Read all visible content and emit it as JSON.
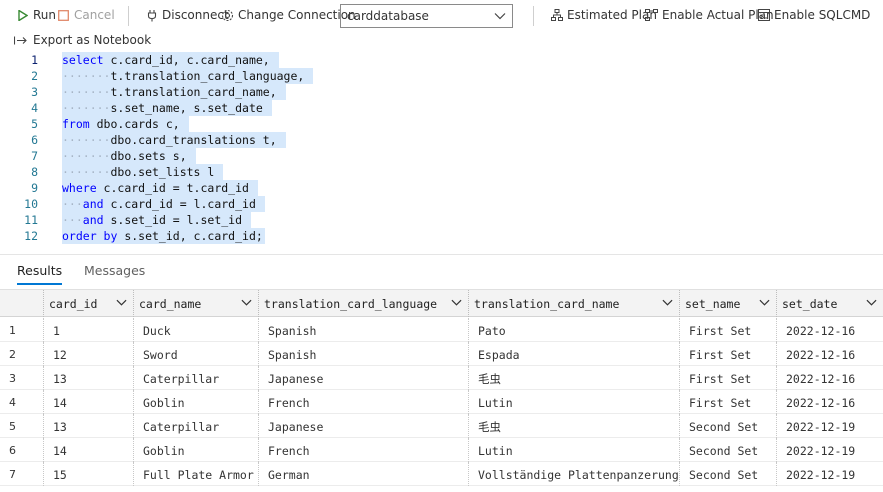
{
  "toolbar": {
    "run_label": "Run",
    "cancel_label": "Cancel",
    "disconnect_label": "Disconnect",
    "change_connection_label": "Change Connection",
    "database_selected": "carddatabase",
    "estimated_plan_label": "Estimated Plan",
    "actual_plan_label": "Enable Actual Plan",
    "sqlcmd_label": "Enable SQLCMD",
    "export_label": "Export as Notebook"
  },
  "editor": {
    "line_numbers": [
      "1",
      "2",
      "3",
      "4",
      "5",
      "6",
      "7",
      "8",
      "9",
      "10",
      "11",
      "12"
    ],
    "lines": [
      {
        "kw": "select",
        "text": " c.card_id, c.card_name, "
      },
      {
        "indent": "·······",
        "text": "t.translation_card_language, "
      },
      {
        "indent": "·······",
        "text": "t.translation_card_name, "
      },
      {
        "indent": "·······",
        "text": "s.set_name, s.set_date "
      },
      {
        "kw": "from",
        "text": " dbo.cards c, "
      },
      {
        "indent": "·······",
        "text": "dbo.card_translations t, "
      },
      {
        "indent": "·······",
        "text": "dbo.sets s, "
      },
      {
        "indent": "·······",
        "text": "dbo.set_lists l "
      },
      {
        "kw": "where",
        "text": " c.card_id = t.card_id "
      },
      {
        "indent": "···",
        "kw": "and",
        "text": " c.card_id = l.card_id "
      },
      {
        "indent": "···",
        "kw": "and",
        "text": " s.set_id = l.set_id "
      },
      {
        "kw": "order by",
        "text": " s.set_id, c.card_id;"
      }
    ]
  },
  "tabs": {
    "results": "Results",
    "messages": "Messages"
  },
  "grid": {
    "columns": [
      "card_id",
      "card_name",
      "translation_card_language",
      "translation_card_name",
      "set_name",
      "set_date"
    ],
    "row_numbers": [
      "1",
      "2",
      "3",
      "4",
      "5",
      "6",
      "7"
    ],
    "rows": [
      [
        "1",
        "Duck",
        "Spanish",
        "Pato",
        "First Set",
        "2022-12-16"
      ],
      [
        "12",
        "Sword",
        "Spanish",
        "Espada",
        "First Set",
        "2022-12-16"
      ],
      [
        "13",
        "Caterpillar",
        "Japanese",
        "毛虫",
        "First Set",
        "2022-12-16"
      ],
      [
        "14",
        "Goblin",
        "French",
        "Lutin",
        "First Set",
        "2022-12-16"
      ],
      [
        "13",
        "Caterpillar",
        "Japanese",
        "毛虫",
        "Second Set",
        "2022-12-19"
      ],
      [
        "14",
        "Goblin",
        "French",
        "Lutin",
        "Second Set",
        "2022-12-19"
      ],
      [
        "15",
        "Full Plate Armor",
        "German",
        "Vollständige Plattenpanzerung",
        "Second Set",
        "2022-12-19"
      ]
    ]
  },
  "colors": {
    "run_green": "#388a34",
    "cancel_red": "#e0896a",
    "keyword_blue": "#0000ff",
    "selection": "#d6e8fb",
    "tab_accent": "#0078d4"
  }
}
